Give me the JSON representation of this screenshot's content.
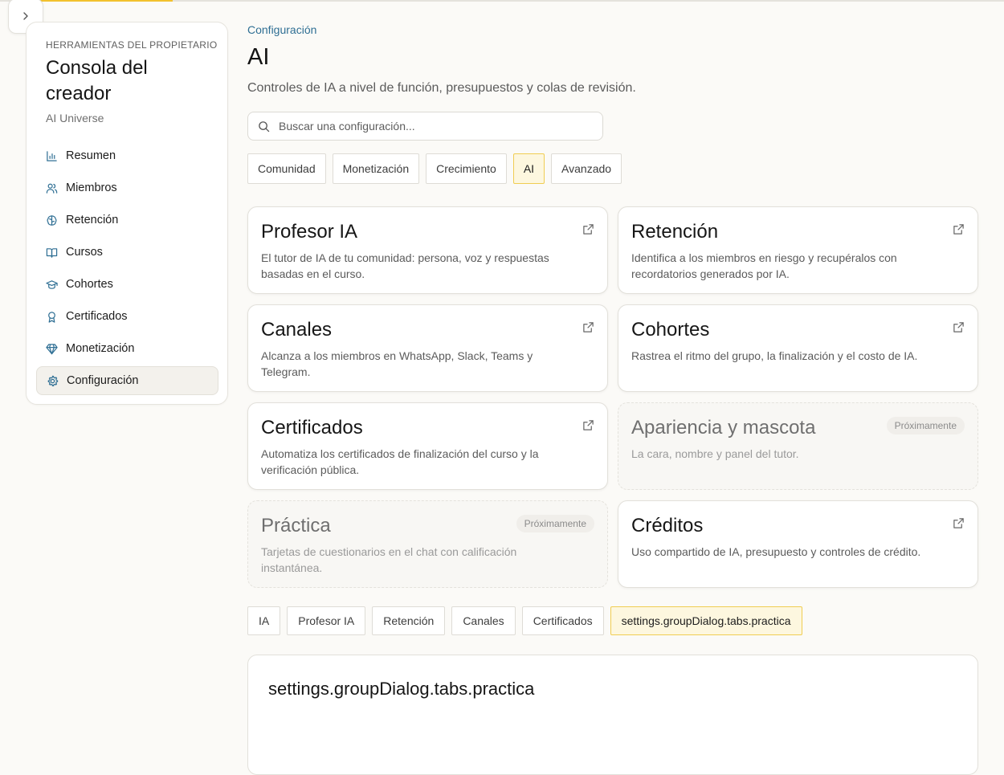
{
  "sidebar": {
    "eyebrow": "HERRAMIENTAS DEL PROPIETARIO",
    "title": "Consola del creador",
    "subtitle": "AI Universe",
    "items": [
      {
        "label": "Resumen",
        "icon": "bar-chart-icon"
      },
      {
        "label": "Miembros",
        "icon": "users-icon"
      },
      {
        "label": "Retención",
        "icon": "brain-icon"
      },
      {
        "label": "Cursos",
        "icon": "book-open-icon"
      },
      {
        "label": "Cohortes",
        "icon": "graduation-cap-icon"
      },
      {
        "label": "Certificados",
        "icon": "award-icon"
      },
      {
        "label": "Monetización",
        "icon": "gem-icon"
      },
      {
        "label": "Configuración",
        "icon": "gear-icon",
        "active": true
      }
    ],
    "icon_color": "#2f6f94"
  },
  "header": {
    "breadcrumb": "Configuración",
    "title": "AI",
    "description": "Controles de IA a nivel de función, presupuestos y colas de revisión."
  },
  "search": {
    "placeholder": "Buscar una configuración...",
    "value": ""
  },
  "category_tabs": [
    {
      "label": "Comunidad",
      "active": false
    },
    {
      "label": "Monetización",
      "active": false
    },
    {
      "label": "Crecimiento",
      "active": false
    },
    {
      "label": "AI",
      "active": true
    },
    {
      "label": "Avanzado",
      "active": false
    }
  ],
  "cards": [
    {
      "title": "Profesor IA",
      "description": "El tutor de IA de tu comunidad: persona, voz y respuestas basadas en el curso.",
      "disabled": false
    },
    {
      "title": "Retención",
      "description": "Identifica a los miembros en riesgo y recupéralos con recordatorios generados por IA.",
      "disabled": false
    },
    {
      "title": "Canales",
      "description": "Alcanza a los miembros en WhatsApp, Slack, Teams y Telegram.",
      "disabled": false
    },
    {
      "title": "Cohortes",
      "description": "Rastrea el ritmo del grupo, la finalización y el costo de IA.",
      "disabled": false
    },
    {
      "title": "Certificados",
      "description": "Automatiza los certificados de finalización del curso y la verificación pública.",
      "disabled": false
    },
    {
      "title": "Apariencia y mascota",
      "description": "La cara, nombre y panel del tutor.",
      "disabled": true,
      "badge": "Próximamente"
    },
    {
      "title": "Práctica",
      "description": "Tarjetas de cuestionarios en el chat con calificación instantánea.",
      "disabled": true,
      "badge": "Próximamente"
    },
    {
      "title": "Créditos",
      "description": "Uso compartido de IA, presupuesto y controles de crédito.",
      "disabled": false
    }
  ],
  "section_tabs": [
    {
      "label": "IA",
      "active": false
    },
    {
      "label": "Profesor IA",
      "active": false
    },
    {
      "label": "Retención",
      "active": false
    },
    {
      "label": "Canales",
      "active": false
    },
    {
      "label": "Certificados",
      "active": false
    },
    {
      "label": "settings.groupDialog.tabs.practica",
      "active": true
    }
  ],
  "panel": {
    "title": "settings.groupDialog.tabs.practica"
  },
  "colors": {
    "accent_yellow": "#f2c12e",
    "link_blue": "#2f6f94",
    "background": "#fbfaf7"
  }
}
